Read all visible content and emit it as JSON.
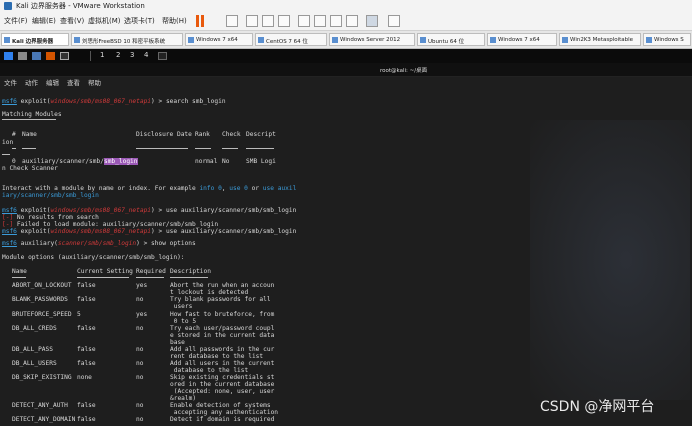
{
  "window": {
    "title": "Kali 边界服务器 - VMware Workstation"
  },
  "menubar": {
    "items": [
      "文件(F)",
      "编辑(E)",
      "查看(V)",
      "虚拟机(M)",
      "选项卡(T)",
      "帮助(H)"
    ]
  },
  "tabs": [
    "Kali 边界服务器",
    "刘思彤FreeBSD 10 和密平板系统",
    "Windows 7 x64",
    "CentOS 7 64 位",
    "Windows Server 2012",
    "Ubuntu 64 位",
    "Windows 7 x64",
    "Win2K3 Metasploitable",
    "Windows S"
  ],
  "vmbar": {
    "workspaces": [
      "1",
      "2",
      "3",
      "4"
    ],
    "window_title": "root@kali: ~/桌面"
  },
  "terminal_menu": [
    "文件",
    "动作",
    "编辑",
    "查看",
    "帮助"
  ],
  "terminal": {
    "prompt_msf6": "msf6",
    "exploit_word": "exploit(",
    "module_path": "windows/smb/ms08_067_netapi",
    "cmd_search": ") > search smb_login",
    "matching_modules": "Matching Modules",
    "headers": {
      "num": "#",
      "name": "Name",
      "date": "Disclosure Date",
      "rank": "Rank",
      "check": "Check",
      "descript": "Descript",
      "ion": "ion"
    },
    "result_row": {
      "num": "0",
      "name_prefix": "auxiliary/scanner/smb/",
      "name_hl": "smb_login",
      "rank": "normal",
      "check": "No",
      "desc": "SMB Logi"
    },
    "result_cont": "n Check Scanner",
    "interact_1": "Interact with a module by name or index. For example ",
    "info0": "info 0",
    "interact_2": ", ",
    "use0": "use 0",
    "interact_3": " or ",
    "useaux": "use auxil",
    "interact_line2": "iary/scanner/smb/smb_login",
    "cmd_use": ") > use auxiliary/scanner/smb/smb_login",
    "err_tag": "[-]",
    "err_1": " No results from search",
    "err_2": " Failed to load module: auxiliary/scanner/smb/smb_login",
    "aux_word": "auxiliary(",
    "aux_path": "scanner/smb/smb_login",
    "cmd_show": ") > show options",
    "module_options": "Module options (auxiliary/scanner/smb/smb_login):",
    "opt_headers": {
      "name": "Name",
      "current": "Current Setting",
      "required": "Required",
      "description": "Description"
    },
    "options": [
      {
        "name": "ABORT_ON_LOCKOUT",
        "current": "false",
        "required": "yes",
        "desc": [
          "Abort the run when an accoun",
          "t lockout is detected"
        ]
      },
      {
        "name": "BLANK_PASSWORDS",
        "current": "false",
        "required": "no",
        "desc": [
          "Try blank passwords for all",
          " users"
        ]
      },
      {
        "name": "BRUTEFORCE_SPEED",
        "current": "5",
        "required": "yes",
        "desc": [
          "How fast to bruteforce, from",
          " 0 to 5"
        ]
      },
      {
        "name": "DB_ALL_CREDS",
        "current": "false",
        "required": "no",
        "desc": [
          "Try each user/password coupl",
          "e stored in the current data",
          "base"
        ]
      },
      {
        "name": "DB_ALL_PASS",
        "current": "false",
        "required": "no",
        "desc": [
          "Add all passwords in the cur",
          "rent database to the list"
        ]
      },
      {
        "name": "DB_ALL_USERS",
        "current": "false",
        "required": "no",
        "desc": [
          "Add all users in the current",
          " database to the list"
        ]
      },
      {
        "name": "DB_SKIP_EXISTING",
        "current": "none",
        "required": "no",
        "desc": [
          "Skip existing credentials st",
          "ored in the current database",
          " (Accepted: none, user, user",
          "&realm)"
        ]
      },
      {
        "name": "DETECT_ANY_AUTH",
        "current": "false",
        "required": "no",
        "desc": [
          "Enable detection of systems",
          " accepting any authentication"
        ]
      },
      {
        "name": "DETECT_ANY_DOMAIN",
        "current": "false",
        "required": "no",
        "desc": [
          "Detect if domain is required"
        ]
      }
    ]
  },
  "watermark": "CSDN @净网平台"
}
